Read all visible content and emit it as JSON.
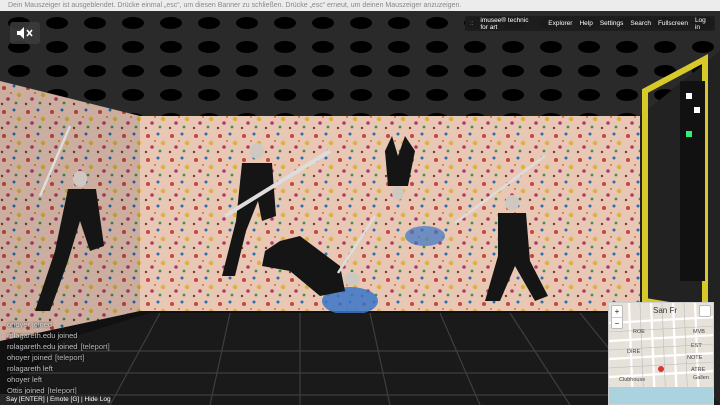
{
  "banner": {
    "text": "Dein Mauszeiger ist ausgeblendet. Drücke einmal „esc“, um diesen Banner zu schließen. Drücke „esc“ erneut, um deinen Mauszeiger anzuzeigen."
  },
  "controls": {
    "mute_icon": "speaker-muted-icon"
  },
  "nav": {
    "grip": "::",
    "brand": "imusee® technic for art",
    "links": [
      "Explorer",
      "Help",
      "Settings",
      "Search",
      "Fullscreen",
      "Log in"
    ]
  },
  "chat": {
    "lines": [
      {
        "text": "ohoyer joined",
        "action": ""
      },
      {
        "text": "rolagareth.edu joined",
        "action": ""
      },
      {
        "text": "rolagareth.edu joined",
        "action": "[teleport]"
      },
      {
        "text": "ohoyer joined",
        "action": "[teleport]"
      },
      {
        "text": "rolagareth left",
        "action": ""
      },
      {
        "text": "ohoyer left",
        "action": ""
      },
      {
        "text": "Ottis joined",
        "action": "[teleport]"
      }
    ]
  },
  "bottombar": {
    "say": "Say [ENTER]",
    "emote": "Emote [G]",
    "hide_log": "Hide Log",
    "separator": " | "
  },
  "minimap": {
    "zoom_in": "+",
    "zoom_out": "−",
    "title": "San Fr",
    "labels": [
      "MVB",
      "EST",
      "ROE",
      "NOTE",
      "DIRE",
      "ATRE",
      "Gallen",
      "Clubhouse"
    ]
  },
  "colors": {
    "banner_bg": "#ececec",
    "nav_bg": "#1c1c1c",
    "floor": "#1a1a1a",
    "frame_yellow": "#d8c92a"
  }
}
